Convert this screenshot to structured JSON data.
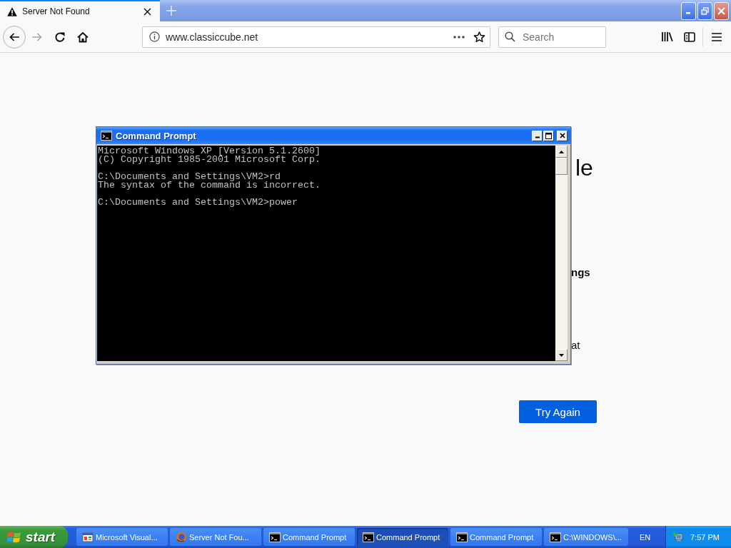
{
  "browser": {
    "tabs": [
      {
        "title": "Server Not Found",
        "selected": true
      }
    ],
    "nav_buttons": [
      {
        "kind": "back",
        "disabled": false
      },
      {
        "kind": "forward",
        "disabled": true
      },
      {
        "kind": "reload",
        "disabled": false
      },
      {
        "kind": "home",
        "disabled": false
      }
    ],
    "address": "www.classiccube.net",
    "search": {
      "placeholder": "Search"
    }
  },
  "page": {
    "fragments": [
      {
        "kind": "heading",
        "text": "le"
      },
      {
        "kind": "label",
        "text": "ngs"
      },
      {
        "kind": "body",
        "text": "at"
      }
    ],
    "button": "Try Again"
  },
  "console_window": {
    "title": "Command Prompt",
    "blocks": [
      [
        "Microsoft Windows XP [Version 5.1.2600]",
        "(C) Copyright 1985-2001 Microsoft Corp."
      ],
      [
        "C:\\Documents and Settings\\VM2>rd",
        "The syntax of the command is incorrect."
      ],
      [
        "C:\\Documents and Settings\\VM2>power"
      ]
    ]
  },
  "taskbar": {
    "start": "start",
    "tasks": [
      {
        "label": "Microsoft Visual...",
        "kind": "app",
        "selected": false
      },
      {
        "label": "Server Not Fou...",
        "kind": "browser",
        "selected": false
      },
      {
        "label": "Command Prompt",
        "kind": "console",
        "selected": false
      },
      {
        "label": "Command Prompt",
        "kind": "console",
        "selected": true
      },
      {
        "label": "Command Prompt",
        "kind": "console",
        "selected": false
      },
      {
        "label": "C:\\WINDOWS\\...",
        "kind": "console",
        "selected": false
      }
    ],
    "language": "EN",
    "clock": "7:57 PM"
  }
}
